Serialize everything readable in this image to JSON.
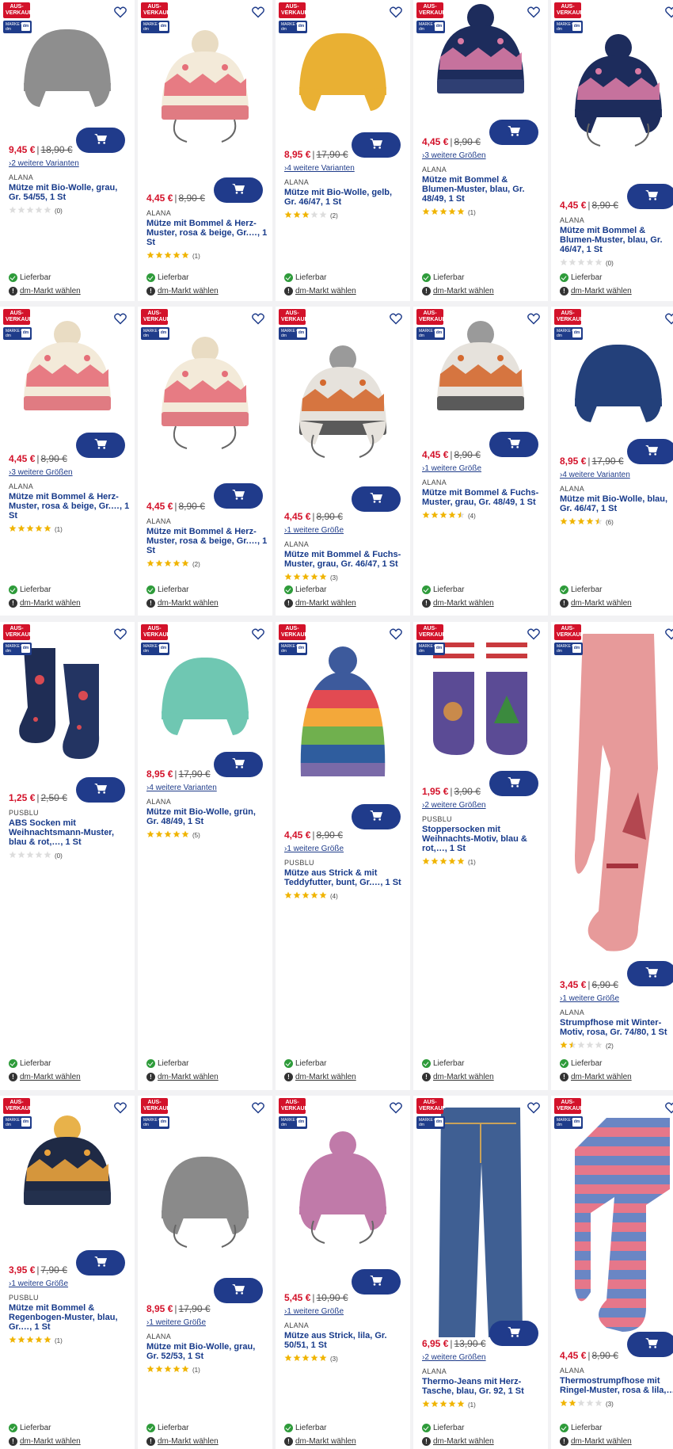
{
  "ui": {
    "sale_badge": "AUS-VERKAUF",
    "brand_badge": "MARKE von dm",
    "availability": "Lieferbar",
    "store_link": "dm-Markt wählen"
  },
  "colors": {
    "brand_blue": "#203b8b",
    "sale_red": "#d3122a",
    "star_gold": "#f0b400",
    "available_green": "#2e9b3a"
  },
  "products": [
    {
      "price": "9,45 €",
      "old_price": "18,90 €",
      "variants": "›2 weitere Varianten",
      "brand": "ALANA",
      "title": "Mütze mit Bio-Wolle, grau, Gr. 54/55, 1 St",
      "rating": 0,
      "reviews": "(0)",
      "icon": "hat-grey-icon"
    },
    {
      "price": "4,45 €",
      "old_price": "8,90 €",
      "variants": "",
      "brand": "ALANA",
      "title": "Mütze mit Bommel & Herz-Muster, rosa & beige, Gr.…, 1 St",
      "rating": 5,
      "reviews": "(1)",
      "icon": "hat-heart-string-icon"
    },
    {
      "price": "8,95 €",
      "old_price": "17,90 €",
      "variants": "›4 weitere Varianten",
      "brand": "ALANA",
      "title": "Mütze mit Bio-Wolle, gelb, Gr. 46/47, 1 St",
      "rating": 3,
      "reviews": "(2)",
      "icon": "hat-yellow-icon"
    },
    {
      "price": "4,45 €",
      "old_price": "8,90 €",
      "variants": "›3 weitere Größen",
      "brand": "ALANA",
      "title": "Mütze mit Bommel & Blumen-Muster, blau, Gr. 48/49, 1 St",
      "rating": 5,
      "reviews": "(1)",
      "icon": "hat-flower-icon"
    },
    {
      "price": "4,45 €",
      "old_price": "8,90 €",
      "variants": "",
      "brand": "ALANA",
      "title": "Mütze mit Bommel & Blumen-Muster, blau, Gr. 46/47, 1 St",
      "rating": 0,
      "reviews": "(0)",
      "icon": "hat-flower-string-icon"
    },
    {
      "price": "4,45 €",
      "old_price": "8,90 €",
      "variants": "›3 weitere Größen",
      "brand": "ALANA",
      "title": "Mütze mit Bommel & Herz-Muster, rosa & beige, Gr.…, 1 St",
      "rating": 5,
      "reviews": "(1)",
      "icon": "hat-heart-icon"
    },
    {
      "price": "4,45 €",
      "old_price": "8,90 €",
      "variants": "",
      "brand": "ALANA",
      "title": "Mütze mit Bommel & Herz-Muster, rosa & beige, Gr.…, 1 St",
      "rating": 5,
      "reviews": "(2)",
      "icon": "hat-heart-string-icon"
    },
    {
      "price": "4,45 €",
      "old_price": "8,90 €",
      "variants": "›1 weitere Größe",
      "brand": "ALANA",
      "title": "Mütze mit Bommel & Fuchs-Muster, grau, Gr. 46/47, 1 St",
      "rating": 5,
      "reviews": "(3)",
      "icon": "hat-fox-string-icon"
    },
    {
      "price": "4,45 €",
      "old_price": "8,90 €",
      "variants": "›1 weitere Größe",
      "brand": "ALANA",
      "title": "Mütze mit Bommel & Fuchs-Muster, grau, Gr. 48/49, 1 St",
      "rating": 4.5,
      "reviews": "(4)",
      "icon": "hat-fox-icon"
    },
    {
      "price": "8,95 €",
      "old_price": "17,90 €",
      "variants": "›4 weitere Varianten",
      "brand": "ALANA",
      "title": "Mütze mit Bio-Wolle, blau, Gr. 46/47, 1 St",
      "rating": 4.5,
      "reviews": "(6)",
      "icon": "hat-blue-icon"
    },
    {
      "price": "1,25 €",
      "old_price": "2,50 €",
      "variants": "",
      "brand": "PUSBLU",
      "title": "ABS Socken mit Weihnachtsmann-Muster, blau & rot,…, 1 St",
      "rating": 0,
      "reviews": "(0)",
      "icon": "socks-santa-icon"
    },
    {
      "price": "8,95 €",
      "old_price": "17,90 €",
      "variants": "›4 weitere Varianten",
      "brand": "ALANA",
      "title": "Mütze mit Bio-Wolle, grün, Gr. 48/49, 1 St",
      "rating": 5,
      "reviews": "(5)",
      "icon": "hat-green-icon"
    },
    {
      "price": "4,45 €",
      "old_price": "8,90 €",
      "variants": "›1 weitere Größe",
      "brand": "PUSBLU",
      "title": "Mütze aus Strick & mit Teddyfutter, bunt, Gr.…, 1 St",
      "rating": 5,
      "reviews": "(4)",
      "icon": "hat-rainbow-stripe-icon"
    },
    {
      "price": "1,95 €",
      "old_price": "3,90 €",
      "variants": "›2 weitere Größen",
      "brand": "PUSBLU",
      "title": "Stoppersocken mit Weihnachts-Motiv, blau & rot,…, 1 St",
      "rating": 5,
      "reviews": "(1)",
      "icon": "socks-gingerbread-icon"
    },
    {
      "price": "3,45 €",
      "old_price": "6,90 €",
      "variants": "›1 weitere Größe",
      "brand": "ALANA",
      "title": "Strumpfhose mit Winter-Motiv, rosa, Gr. 74/80, 1 St",
      "rating": 1.5,
      "reviews": "(2)",
      "icon": "tights-pink-icon"
    },
    {
      "price": "3,95 €",
      "old_price": "7,90 €",
      "variants": "›1 weitere Größe",
      "brand": "PUSBLU",
      "title": "Mütze mit Bommel & Regenbogen-Muster, blau, Gr.…, 1 St",
      "rating": 5,
      "reviews": "(1)",
      "icon": "hat-rainbow-icon"
    },
    {
      "price": "8,95 €",
      "old_price": "17,90 €",
      "variants": "›1 weitere Größe",
      "brand": "ALANA",
      "title": "Mütze mit Bio-Wolle, grau, Gr. 52/53, 1 St",
      "rating": 5,
      "reviews": "(1)",
      "icon": "hat-grey-string-icon"
    },
    {
      "price": "5,45 €",
      "old_price": "10,90 €",
      "variants": "›1 weitere Größe",
      "brand": "ALANA",
      "title": "Mütze aus Strick, lila, Gr. 50/51, 1 St",
      "rating": 5,
      "reviews": "(3)",
      "icon": "hat-lilac-icon"
    },
    {
      "price": "6,95 €",
      "old_price": "13,90 €",
      "variants": "›2 weitere Größen",
      "brand": "ALANA",
      "title": "Thermo-Jeans mit Herz-Tasche, blau, Gr. 92, 1 St",
      "rating": 5,
      "reviews": "(1)",
      "icon": "jeans-icon"
    },
    {
      "price": "4,45 €",
      "old_price": "8,90 €",
      "variants": "",
      "brand": "ALANA",
      "title": "Thermostrumpfhose mit Ringel-Muster, rosa & lila,…",
      "rating": 2,
      "reviews": "(3)",
      "icon": "tights-stripe-icon"
    }
  ]
}
